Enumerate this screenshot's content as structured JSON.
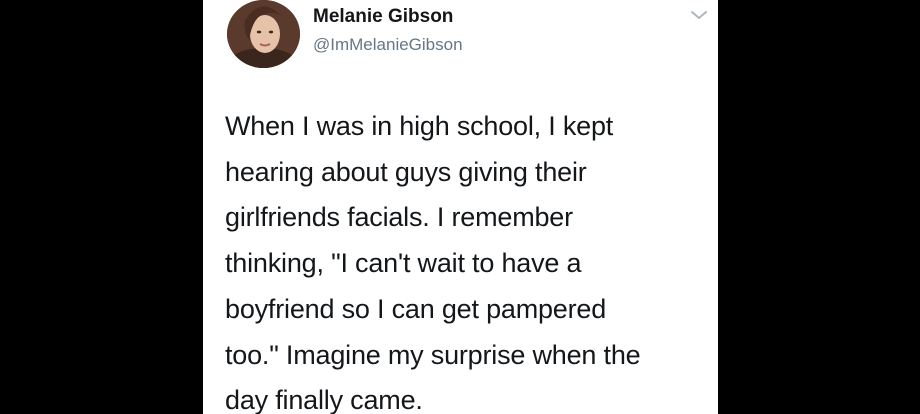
{
  "tweet": {
    "author_name": "Melanie Gibson",
    "author_handle": "@ImMelanieGibson",
    "text_lines": [
      "When I was in high school, I kept",
      "hearing about guys giving their",
      "girlfriends facials. I remember",
      "thinking, \"I can't wait to have a",
      "boyfriend so I can get pampered",
      "too.\" Imagine my surprise when the",
      "day finally came."
    ]
  },
  "icons": {
    "avatar": "profile-photo",
    "menu": "chevron-down-icon"
  },
  "colors": {
    "background": "#000000",
    "card": "#ffffff",
    "text": "#14171a",
    "secondary_text": "#657786",
    "chevron": "#aab8c2"
  }
}
